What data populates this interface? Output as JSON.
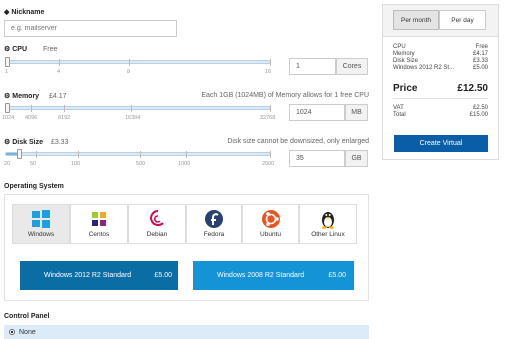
{
  "nickname": {
    "label": "Nickname",
    "placeholder": "e.g. mailserver"
  },
  "cpu": {
    "label": "CPU",
    "price": "Free",
    "ticks": [
      "1",
      "4",
      "8",
      "16"
    ],
    "value": "1",
    "unit": "Cores",
    "slider_fraction": 0.0
  },
  "memory": {
    "label": "Memory",
    "price": "£4.17",
    "note": "Each 1GB (1024MB) of Memory allows for 1 free CPU",
    "ticks": [
      "1024",
      "4096",
      "8192",
      "16384",
      "32768"
    ],
    "value": "1024",
    "unit": "MB",
    "slider_fraction": 0.0
  },
  "disk": {
    "label": "Disk Size",
    "price": "£3.33",
    "note": "Disk size cannot be downsized, only enlarged",
    "ticks": [
      "20",
      "50",
      "100",
      "500",
      "1000",
      "2000"
    ],
    "value": "35",
    "unit": "GB",
    "slider_fraction": 0.05
  },
  "os_section": {
    "title": "Operating System",
    "options": [
      {
        "name": "Windows",
        "icon": "windows-icon",
        "selected": true
      },
      {
        "name": "Centos",
        "icon": "centos-icon",
        "selected": false
      },
      {
        "name": "Debian",
        "icon": "debian-icon",
        "selected": false
      },
      {
        "name": "Fedora",
        "icon": "fedora-icon",
        "selected": false
      },
      {
        "name": "Ubuntu",
        "icon": "ubuntu-icon",
        "selected": false
      },
      {
        "name": "Other Linux",
        "icon": "tux-icon",
        "selected": false
      }
    ],
    "versions": [
      {
        "name": "Windows 2012 R2 Standard",
        "price": "£5.00",
        "color": "#0a6ea5"
      },
      {
        "name": "Windows 2008 R2 Standard",
        "price": "£5.00",
        "color": "#1493d6"
      }
    ]
  },
  "control_panel": {
    "title": "Control Panel",
    "option": "None"
  },
  "summary": {
    "tabs": [
      "Per month",
      "Per day"
    ],
    "active_tab": "Per month",
    "rows": [
      {
        "label": "CPU",
        "value": "Free"
      },
      {
        "label": "Memory",
        "value": "£4.17"
      },
      {
        "label": "Disk Size",
        "value": "£3.33"
      },
      {
        "label": "Windows 2012 R2 St...",
        "value": "£5.00"
      }
    ],
    "price_label": "Price",
    "price_value": "£12.50",
    "tax_rows": [
      {
        "label": "VAT",
        "value": "£2.50"
      },
      {
        "label": "Total",
        "value": "£15.00"
      }
    ],
    "button": "Create Virtual"
  },
  "colors": {
    "accent": "#0a5ea8",
    "slider_fill": "#7fb0de",
    "selected_bg": "#e9e9e9",
    "control_panel_bg": "#dbecf8"
  }
}
